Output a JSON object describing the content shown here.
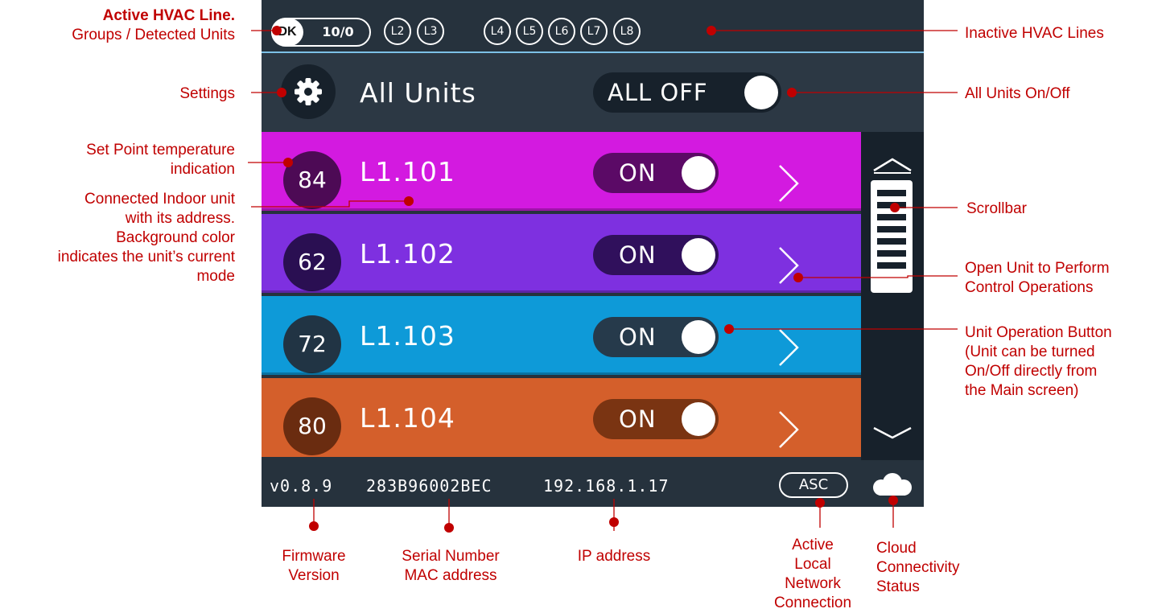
{
  "colors": {
    "annotation": "#c00000",
    "screen_bg": "#26323d",
    "unit_cool_magenta": "#d31ae0",
    "unit_purple": "#7e30e0",
    "unit_blue": "#0e9ad8",
    "unit_orange": "#d45f2b"
  },
  "topbar": {
    "active_line_label": "DK",
    "groups_detected": "10/0",
    "lines": [
      "L2",
      "L3",
      "L4",
      "L5",
      "L6",
      "L7",
      "L8"
    ]
  },
  "all_units": {
    "title": "All Units",
    "toggle_label": "ALL OFF",
    "settings_icon": "gear-icon"
  },
  "units": [
    {
      "setpoint": "84",
      "address": "L1.101",
      "state": "ON",
      "color": "#d31ae0",
      "circle": "#4d0a55",
      "toggle_bg": "#5b0a66"
    },
    {
      "setpoint": "62",
      "address": "L1.102",
      "state": "ON",
      "color": "#7e30e0",
      "circle": "#2a0f52",
      "toggle_bg": "#30105c"
    },
    {
      "setpoint": "72",
      "address": "L1.103",
      "state": "ON",
      "color": "#0e9ad8",
      "circle": "#213444",
      "toggle_bg": "#263a4b"
    },
    {
      "setpoint": "80",
      "address": "L1.104",
      "state": "ON",
      "color": "#d45f2b",
      "circle": "#6a2c10",
      "toggle_bg": "#7a3412"
    }
  ],
  "statusbar": {
    "firmware": "v0.8.9",
    "serial": "283B96002BEC",
    "ip": "192.168.1.17",
    "asc": "ASC",
    "cloud_icon": "cloud-icon"
  },
  "annotations": {
    "active_line_bold": "Active HVAC Line",
    "active_line_rest": "Groups / Detected Units",
    "inactive_lines": "Inactive HVAC Lines",
    "settings": "Settings",
    "all_units_onoff": "All Units On/Off",
    "setpoint": [
      "Set Point temperature",
      "indication"
    ],
    "indoor_unit": [
      "Connected Indoor unit",
      "with its address.",
      "Background color",
      "indicates the unit’s current",
      "mode"
    ],
    "scrollbar": "Scrollbar",
    "open_unit": [
      "Open Unit to Perform",
      "Control Operations"
    ],
    "unit_operation": [
      "Unit Operation Button",
      "(Unit can be turned",
      "On/Off directly from",
      "the Main screen)"
    ],
    "firmware": [
      "Firmware",
      "Version"
    ],
    "serial": [
      "Serial Number",
      "MAC address"
    ],
    "ip": "IP address",
    "local_network": [
      "Active",
      "Local",
      "Network",
      "Connection"
    ],
    "cloud": [
      "Cloud",
      "Connectivity",
      "Status"
    ]
  }
}
